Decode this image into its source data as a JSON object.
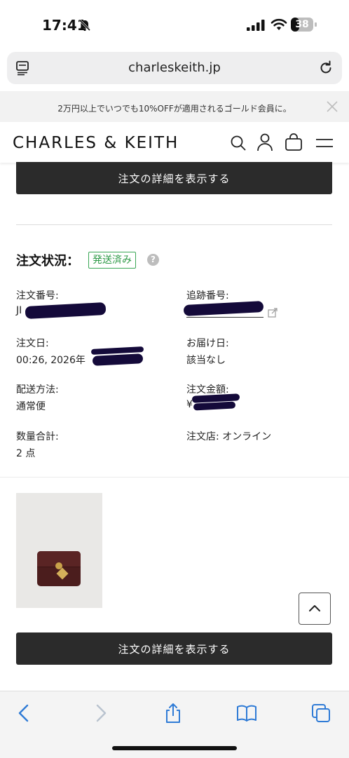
{
  "status_bar": {
    "time": "17:41",
    "battery": "38",
    "battery_level": 0.38
  },
  "browser": {
    "url": "charleskeith.jp"
  },
  "promo": {
    "text": "2万円以上でいつでも10%OFFが適用されるゴールド会員に。"
  },
  "header": {
    "logo": "CHARLES & KEITH"
  },
  "order": {
    "details_button": "注文の詳細を表示する",
    "status_label": "注文状況：",
    "status_badge": "発送済み",
    "help": "?",
    "fields": {
      "order_number": {
        "label": "注文番号:",
        "value": "JI"
      },
      "tracking_number": {
        "label": "追跡番号:"
      },
      "order_date": {
        "label": "注文日:",
        "value": "00:26, 2026年"
      },
      "delivery_date": {
        "label": "お届け日:",
        "value": "該当なし"
      },
      "shipping_method": {
        "label": "配送方法:",
        "value": "通常便"
      },
      "order_total": {
        "label": "注文金額:",
        "value": "¥"
      },
      "quantity": {
        "label": "数量合計:",
        "value": "2 点"
      },
      "store": {
        "label": "注文店: オンライン"
      }
    }
  },
  "colors": {
    "accent_green": "#2f9a48",
    "button_dark": "#2b2b2b",
    "ios_blue": "#2f7bd6"
  }
}
